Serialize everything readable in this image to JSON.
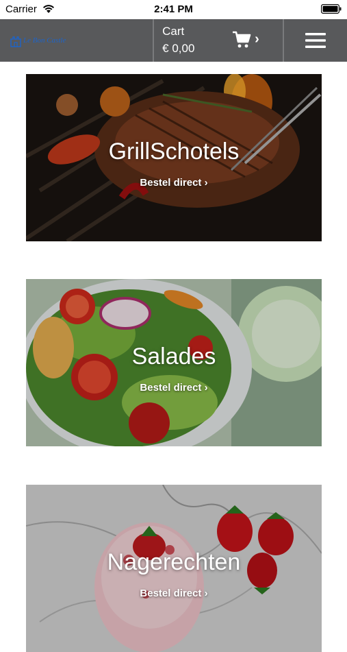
{
  "status_bar": {
    "carrier": "Carrier",
    "time": "2:41 PM"
  },
  "header": {
    "logo_text": "Le Bon Castle",
    "cart_label": "Cart",
    "cart_total": "€ 0,00",
    "cart_chevron": "›",
    "cart_icon": "shopping-cart-icon",
    "menu_icon": "hamburger-menu-icon"
  },
  "categories": [
    {
      "title": "GrillSchotels",
      "link": "Bestel direct ›"
    },
    {
      "title": "Salades",
      "link": "Bestel direct ›"
    },
    {
      "title": "Nagerechten",
      "link": "Bestel direct ›"
    }
  ]
}
